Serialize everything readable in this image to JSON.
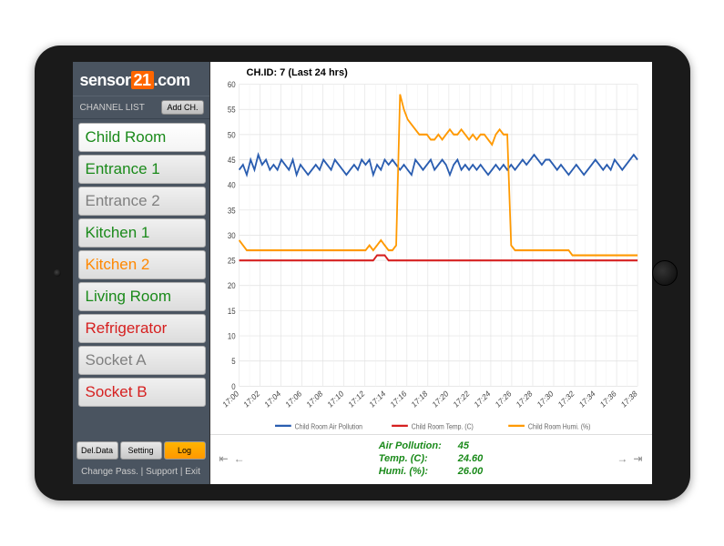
{
  "logo": {
    "prefix": "sensor",
    "box": "21",
    "suffix": ".com"
  },
  "sidebar": {
    "channel_list_label": "CHANNEL LIST",
    "add_button": "Add CH.",
    "items": [
      {
        "label": "Child Room",
        "color": "#1a8a1a",
        "selected": true
      },
      {
        "label": "Entrance 1",
        "color": "#1a8a1a",
        "selected": false
      },
      {
        "label": "Entrance 2",
        "color": "#808080",
        "selected": false
      },
      {
        "label": "Kitchen 1",
        "color": "#1a8a1a",
        "selected": false
      },
      {
        "label": "Kitchen 2",
        "color": "#ff8800",
        "selected": false
      },
      {
        "label": "Living Room",
        "color": "#1a8a1a",
        "selected": false
      },
      {
        "label": "Refrigerator",
        "color": "#d62020",
        "selected": false
      },
      {
        "label": "Socket A",
        "color": "#808080",
        "selected": false
      },
      {
        "label": "Socket B",
        "color": "#d62020",
        "selected": false
      }
    ],
    "buttons": {
      "del": "Del.Data",
      "setting": "Setting",
      "log": "Log"
    },
    "footer": {
      "change_pass": "Change Pass.",
      "support": "Support",
      "exit": "Exit",
      "sep": " | "
    }
  },
  "main": {
    "chart_title": "CH.ID: 7 (Last 24 hrs)",
    "readings": {
      "air_label": "Air Pollution:",
      "air_value": "45",
      "temp_label": "Temp. (C):",
      "temp_value": "24.60",
      "humi_label": "Humi. (%):",
      "humi_value": "26.00"
    }
  },
  "chart_data": {
    "type": "line",
    "xlabel": "",
    "ylabel": "",
    "ylim": [
      0,
      60
    ],
    "y_ticks": [
      0,
      5,
      10,
      15,
      20,
      25,
      30,
      35,
      40,
      45,
      50,
      55,
      60
    ],
    "x_labels": [
      "17:00",
      "17:02",
      "17:04",
      "17:06",
      "17:08",
      "17:10",
      "17:12",
      "17:14",
      "17:16",
      "17:18",
      "17:20",
      "17:22",
      "17:24",
      "17:26",
      "17:28",
      "17:30",
      "17:32",
      "17:34",
      "17:36",
      "17:38"
    ],
    "legend": [
      "Child Room Air Pollution",
      "Child Room Temp. (C)",
      "Child Room Humi. (%)"
    ],
    "colors": {
      "air": "#2a5db0",
      "temp": "#d62020",
      "humi": "#ff9900"
    },
    "series": [
      {
        "name": "Child Room Air Pollution",
        "color": "#2a5db0",
        "values": [
          43,
          44,
          42,
          45,
          43,
          46,
          44,
          45,
          43,
          44,
          43,
          45,
          44,
          43,
          45,
          42,
          44,
          43,
          42,
          43,
          44,
          43,
          45,
          44,
          43,
          45,
          44,
          43,
          42,
          43,
          44,
          43,
          45,
          44,
          45,
          42,
          44,
          43,
          45,
          44,
          45,
          44,
          43,
          44,
          43,
          42,
          45,
          44,
          43,
          44,
          45,
          43,
          44,
          45,
          44,
          42,
          44,
          45,
          43,
          44,
          43,
          44,
          43,
          44,
          43,
          42,
          43,
          44,
          43,
          44,
          43,
          44,
          43,
          44,
          45,
          44,
          45,
          46,
          45,
          44,
          45,
          45,
          44,
          43,
          44,
          43,
          42,
          43,
          44,
          43,
          42,
          43,
          44,
          45,
          44,
          43,
          44,
          43,
          45,
          44,
          43,
          44,
          45,
          46,
          45
        ]
      },
      {
        "name": "Child Room Temp. (C)",
        "color": "#d62020",
        "values": [
          25,
          25,
          25,
          25,
          25,
          25,
          25,
          25,
          25,
          25,
          25,
          25,
          25,
          25,
          25,
          25,
          25,
          25,
          25,
          25,
          25,
          25,
          25,
          25,
          25,
          25,
          25,
          25,
          25,
          25,
          25,
          25,
          25,
          25,
          25,
          25,
          26,
          26,
          26,
          25,
          25,
          25,
          25,
          25,
          25,
          25,
          25,
          25,
          25,
          25,
          25,
          25,
          25,
          25,
          25,
          25,
          25,
          25,
          25,
          25,
          25,
          25,
          25,
          25,
          25,
          25,
          25,
          25,
          25,
          25,
          25,
          25,
          25,
          25,
          25,
          25,
          25,
          25,
          25,
          25,
          25,
          25,
          25,
          25,
          25,
          25,
          25,
          25,
          25,
          25,
          25,
          25,
          25,
          25,
          25,
          25,
          25,
          25,
          25,
          25,
          25,
          25,
          25,
          25,
          25
        ]
      },
      {
        "name": "Child Room Humi. (%)",
        "color": "#ff9900",
        "values": [
          29,
          28,
          27,
          27,
          27,
          27,
          27,
          27,
          27,
          27,
          27,
          27,
          27,
          27,
          27,
          27,
          27,
          27,
          27,
          27,
          27,
          27,
          27,
          27,
          27,
          27,
          27,
          27,
          27,
          27,
          27,
          27,
          27,
          27,
          28,
          27,
          28,
          29,
          28,
          27,
          27,
          28,
          58,
          55,
          53,
          52,
          51,
          50,
          50,
          50,
          49,
          49,
          50,
          49,
          50,
          51,
          50,
          50,
          51,
          50,
          49,
          50,
          49,
          50,
          50,
          49,
          48,
          50,
          51,
          50,
          50,
          28,
          27,
          27,
          27,
          27,
          27,
          27,
          27,
          27,
          27,
          27,
          27,
          27,
          27,
          27,
          27,
          26,
          26,
          26,
          26,
          26,
          26,
          26,
          26,
          26,
          26,
          26,
          26,
          26,
          26,
          26,
          26,
          26,
          26
        ]
      }
    ]
  }
}
